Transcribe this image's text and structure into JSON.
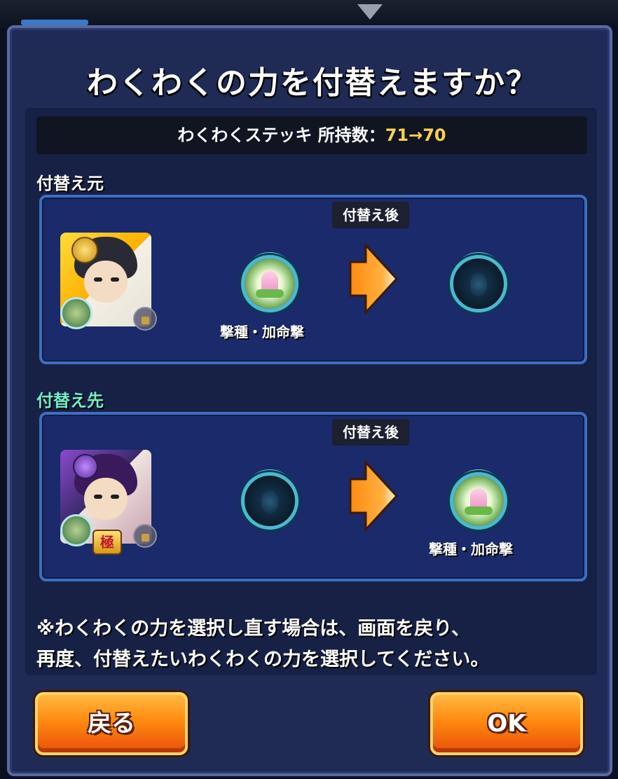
{
  "dialog": {
    "title": "わくわくの力を付替えますか？",
    "stock_label": "わくわくステッキ 所持数：",
    "stock_value": "71→70"
  },
  "source": {
    "section_label": "付替え元",
    "after_tag": "付替え後",
    "current_skill": "撃種・加命撃",
    "after_skill": ""
  },
  "target": {
    "section_label": "付替え先",
    "after_tag": "付替え後",
    "current_skill": "",
    "after_skill": "撃種・加命撃",
    "kyoku_badge": "極"
  },
  "note": {
    "line1": "※わくわくの力を選択し直す場合は、画面を戻り、",
    "line2": "再度、付替えたいわくわくの力を選択してください。"
  },
  "buttons": {
    "back": "戻る",
    "ok": "OK"
  },
  "colors": {
    "dialog_bg": "#1f2b55",
    "card_bg": "#1a2a6a",
    "accent_yellow": "#ffd24a",
    "target_label": "#6ff0c8",
    "button_orange": "#ff8a10"
  }
}
